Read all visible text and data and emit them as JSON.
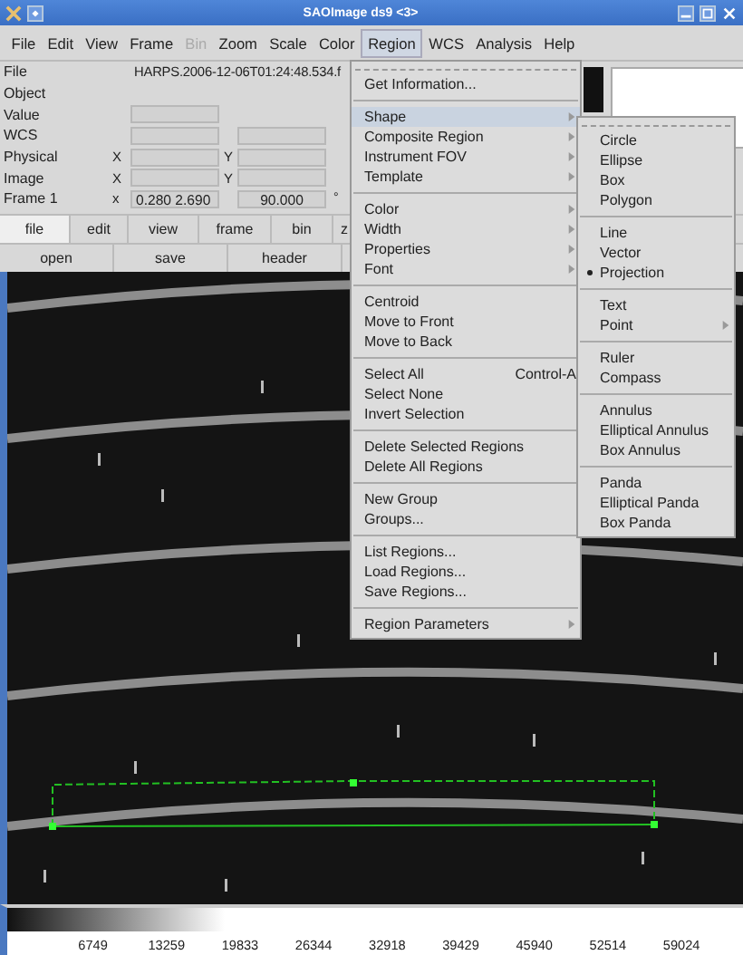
{
  "window": {
    "title": "SAOImage ds9 <3>"
  },
  "menubar": [
    {
      "label": "File",
      "selected": false,
      "disabled": false
    },
    {
      "label": "Edit",
      "selected": false,
      "disabled": false
    },
    {
      "label": "View",
      "selected": false,
      "disabled": false
    },
    {
      "label": "Frame",
      "selected": false,
      "disabled": false
    },
    {
      "label": "Bin",
      "selected": false,
      "disabled": true
    },
    {
      "label": "Zoom",
      "selected": false,
      "disabled": false
    },
    {
      "label": "Scale",
      "selected": false,
      "disabled": false
    },
    {
      "label": "Color",
      "selected": false,
      "disabled": false
    },
    {
      "label": "Region",
      "selected": true,
      "disabled": false
    },
    {
      "label": "WCS",
      "selected": false,
      "disabled": false
    },
    {
      "label": "Analysis",
      "selected": false,
      "disabled": false
    },
    {
      "label": "Help",
      "selected": false,
      "disabled": false
    }
  ],
  "info_panel": {
    "file": {
      "label": "File",
      "value": "HARPS.2006-12-06T01:24:48.534.f"
    },
    "object": {
      "label": "Object"
    },
    "value": {
      "label": "Value"
    },
    "wcs": {
      "label": "WCS"
    },
    "physical": {
      "label": "Physical",
      "x_label": "X",
      "y_label": "Y"
    },
    "image": {
      "label": "Image",
      "x_label": "X",
      "y_label": "Y"
    },
    "frame": {
      "label": "Frame 1",
      "x_label": "x",
      "zoom": "0.280 2.690",
      "angle": "90.000",
      "unit": "°"
    }
  },
  "button_bar": {
    "tabs": [
      {
        "label": "file",
        "selected": true
      },
      {
        "label": "edit",
        "selected": false
      },
      {
        "label": "view",
        "selected": false
      },
      {
        "label": "frame",
        "selected": false
      },
      {
        "label": "bin",
        "selected": false
      },
      {
        "label": "z",
        "selected": false
      }
    ],
    "buttons": [
      "open",
      "save",
      "header"
    ]
  },
  "region_menu": [
    {
      "kind": "item",
      "label": "Get Information...",
      "submenu": false,
      "selected": false
    },
    {
      "kind": "separator"
    },
    {
      "kind": "item",
      "label": "Shape",
      "submenu": true,
      "selected": true
    },
    {
      "kind": "item",
      "label": "Composite Region",
      "submenu": true,
      "selected": false
    },
    {
      "kind": "item",
      "label": "Instrument FOV",
      "submenu": true,
      "selected": false
    },
    {
      "kind": "item",
      "label": "Template",
      "submenu": true,
      "selected": false
    },
    {
      "kind": "separator"
    },
    {
      "kind": "item",
      "label": "Color",
      "submenu": true,
      "selected": false
    },
    {
      "kind": "item",
      "label": "Width",
      "submenu": true,
      "selected": false
    },
    {
      "kind": "item",
      "label": "Properties",
      "submenu": true,
      "selected": false
    },
    {
      "kind": "item",
      "label": "Font",
      "submenu": true,
      "selected": false
    },
    {
      "kind": "separator"
    },
    {
      "kind": "item",
      "label": "Centroid",
      "submenu": false,
      "selected": false
    },
    {
      "kind": "item",
      "label": "Move to Front",
      "submenu": false,
      "selected": false
    },
    {
      "kind": "item",
      "label": "Move to Back",
      "submenu": false,
      "selected": false
    },
    {
      "kind": "separator"
    },
    {
      "kind": "item",
      "label": "Select All",
      "shortcut": "Control-A",
      "submenu": false,
      "selected": false
    },
    {
      "kind": "item",
      "label": "Select None",
      "submenu": false,
      "selected": false
    },
    {
      "kind": "item",
      "label": "Invert Selection",
      "submenu": false,
      "selected": false
    },
    {
      "kind": "separator"
    },
    {
      "kind": "item",
      "label": "Delete Selected Regions",
      "submenu": false,
      "selected": false
    },
    {
      "kind": "item",
      "label": "Delete All Regions",
      "submenu": false,
      "selected": false
    },
    {
      "kind": "separator"
    },
    {
      "kind": "item",
      "label": "New Group",
      "submenu": false,
      "selected": false
    },
    {
      "kind": "item",
      "label": "Groups...",
      "submenu": false,
      "selected": false
    },
    {
      "kind": "separator"
    },
    {
      "kind": "item",
      "label": "List Regions...",
      "submenu": false,
      "selected": false
    },
    {
      "kind": "item",
      "label": "Load Regions...",
      "submenu": false,
      "selected": false
    },
    {
      "kind": "item",
      "label": "Save Regions...",
      "submenu": false,
      "selected": false
    },
    {
      "kind": "separator"
    },
    {
      "kind": "item",
      "label": "Region Parameters",
      "submenu": true,
      "selected": false
    }
  ],
  "shape_submenu": [
    {
      "kind": "item",
      "label": "Circle",
      "submenu": false,
      "checked": false
    },
    {
      "kind": "item",
      "label": "Ellipse",
      "submenu": false,
      "checked": false
    },
    {
      "kind": "item",
      "label": "Box",
      "submenu": false,
      "checked": false
    },
    {
      "kind": "item",
      "label": "Polygon",
      "submenu": false,
      "checked": false
    },
    {
      "kind": "separator"
    },
    {
      "kind": "item",
      "label": "Line",
      "submenu": false,
      "checked": false
    },
    {
      "kind": "item",
      "label": "Vector",
      "submenu": false,
      "checked": false
    },
    {
      "kind": "item",
      "label": "Projection",
      "submenu": false,
      "checked": true
    },
    {
      "kind": "separator"
    },
    {
      "kind": "item",
      "label": "Text",
      "submenu": false,
      "checked": false
    },
    {
      "kind": "item",
      "label": "Point",
      "submenu": true,
      "checked": false
    },
    {
      "kind": "separator"
    },
    {
      "kind": "item",
      "label": "Ruler",
      "submenu": false,
      "checked": false
    },
    {
      "kind": "item",
      "label": "Compass",
      "submenu": false,
      "checked": false
    },
    {
      "kind": "separator"
    },
    {
      "kind": "item",
      "label": "Annulus",
      "submenu": false,
      "checked": false
    },
    {
      "kind": "item",
      "label": "Elliptical Annulus",
      "submenu": false,
      "checked": false
    },
    {
      "kind": "item",
      "label": "Box Annulus",
      "submenu": false,
      "checked": false
    },
    {
      "kind": "separator"
    },
    {
      "kind": "item",
      "label": "Panda",
      "submenu": false,
      "checked": false
    },
    {
      "kind": "item",
      "label": "Elliptical Panda",
      "submenu": false,
      "checked": false
    },
    {
      "kind": "item",
      "label": "Box Panda",
      "submenu": false,
      "checked": false
    }
  ],
  "colorbar": {
    "ticks": [
      "6749",
      "13259",
      "19833",
      "26344",
      "32918",
      "39429",
      "45940",
      "52514",
      "59024"
    ]
  }
}
